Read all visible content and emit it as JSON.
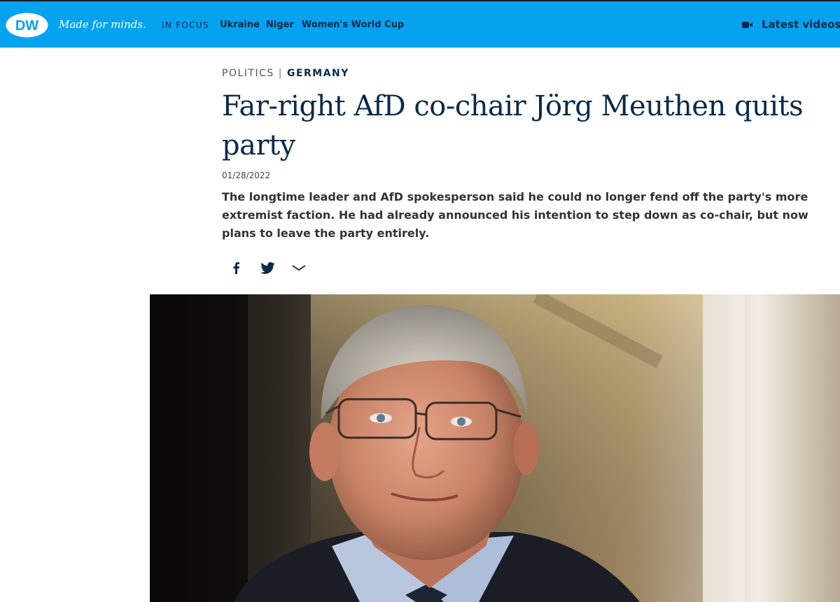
{
  "header": {
    "brand": "DW",
    "tagline": "Made for minds.",
    "in_focus_label": "IN FOCUS",
    "nav_items": [
      "Ukraine",
      "Niger",
      "Women's World Cup"
    ],
    "latest_videos": "Latest videos",
    "colors": {
      "bar": "#05a2f0",
      "text": "#0a2a4a"
    }
  },
  "article": {
    "category": "POLITICS",
    "separator": "|",
    "subcategory": "GERMANY",
    "title": "Far-right AfD co-chair Jörg Meuthen quits party",
    "date": "01/28/2022",
    "teaser": "The longtime leader and AfD spokesperson said he could no longer fend off the party's more extremist faction. He had already announced his intention to step down as co-chair, but now plans to leave the party entirely.",
    "share_icons": [
      "facebook-icon",
      "twitter-icon",
      "chevron-down-icon"
    ]
  }
}
